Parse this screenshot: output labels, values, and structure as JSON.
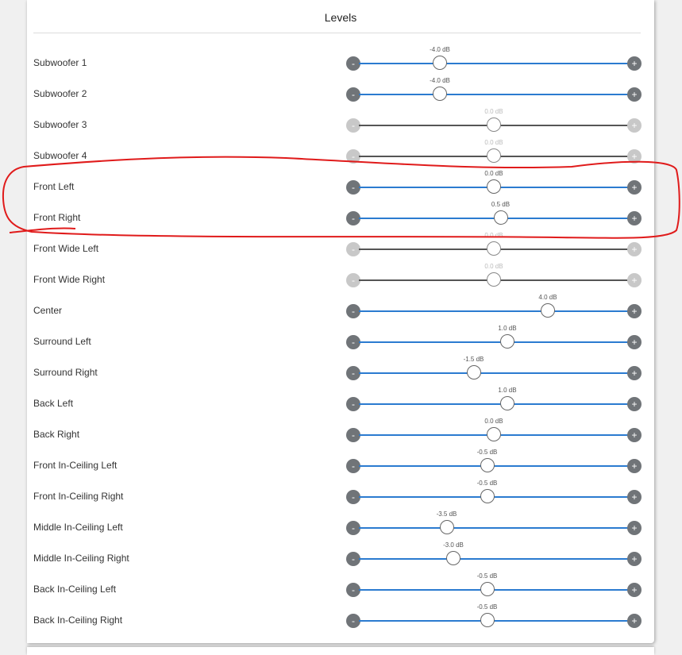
{
  "title": "Levels",
  "colors": {
    "active_track": "#2b7bd0",
    "inactive_track": "#555555",
    "annotation": "#e01b1b"
  },
  "buttons": {
    "minus": "-",
    "plus": "+"
  },
  "slider_range_db": [
    -10,
    10
  ],
  "channels": [
    {
      "label": "Subwoofer 1",
      "value_text": "-4.0 dB",
      "value": -4.0,
      "enabled": true
    },
    {
      "label": "Subwoofer 2",
      "value_text": "-4.0 dB",
      "value": -4.0,
      "enabled": true
    },
    {
      "label": "Subwoofer 3",
      "value_text": "0.0 dB",
      "value": 0.0,
      "enabled": false
    },
    {
      "label": "Subwoofer 4",
      "value_text": "0.0 dB",
      "value": 0.0,
      "enabled": false
    },
    {
      "label": "Front Left",
      "value_text": "0.0 dB",
      "value": 0.0,
      "enabled": true
    },
    {
      "label": "Front Right",
      "value_text": "0.5 dB",
      "value": 0.5,
      "enabled": true
    },
    {
      "label": "Front Wide Left",
      "value_text": "0.0 dB",
      "value": 0.0,
      "enabled": false
    },
    {
      "label": "Front Wide Right",
      "value_text": "0.0 dB",
      "value": 0.0,
      "enabled": false
    },
    {
      "label": "Center",
      "value_text": "4.0 dB",
      "value": 4.0,
      "enabled": true
    },
    {
      "label": "Surround Left",
      "value_text": "1.0 dB",
      "value": 1.0,
      "enabled": true
    },
    {
      "label": "Surround Right",
      "value_text": "-1.5 dB",
      "value": -1.5,
      "enabled": true
    },
    {
      "label": "Back Left",
      "value_text": "1.0 dB",
      "value": 1.0,
      "enabled": true
    },
    {
      "label": "Back Right",
      "value_text": "0.0 dB",
      "value": 0.0,
      "enabled": true
    },
    {
      "label": "Front In-Ceiling Left",
      "value_text": "-0.5 dB",
      "value": -0.5,
      "enabled": true
    },
    {
      "label": "Front In-Ceiling Right",
      "value_text": "-0.5 dB",
      "value": -0.5,
      "enabled": true
    },
    {
      "label": "Middle In-Ceiling Left",
      "value_text": "-3.5 dB",
      "value": -3.5,
      "enabled": true
    },
    {
      "label": "Middle In-Ceiling Right",
      "value_text": "-3.0 dB",
      "value": -3.0,
      "enabled": true
    },
    {
      "label": "Back In-Ceiling Left",
      "value_text": "-0.5 dB",
      "value": -0.5,
      "enabled": true
    },
    {
      "label": "Back In-Ceiling Right",
      "value_text": "-0.5 dB",
      "value": -0.5,
      "enabled": true
    }
  ]
}
